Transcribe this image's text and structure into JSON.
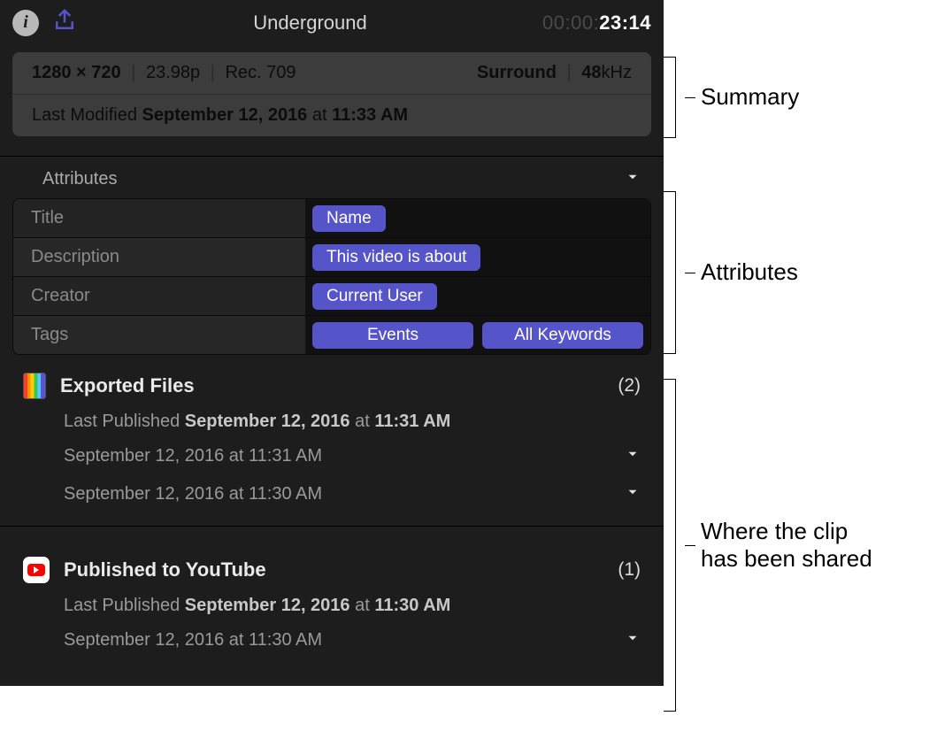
{
  "titlebar": {
    "clip_title": "Underground",
    "timecode_dim": "00:00:",
    "timecode_bright": "23:14"
  },
  "summary": {
    "resolution": "1280 × 720",
    "framerate": "23.98p",
    "colorspace": "Rec. 709",
    "audio_mode": "Surround",
    "audio_rate_num": "48",
    "audio_rate_unit": "kHz",
    "modified_prefix": "Last Modified",
    "modified_date": "September 12, 2016",
    "modified_at": "at",
    "modified_time": "11:33 AM"
  },
  "attributes": {
    "header": "Attributes",
    "rows": [
      {
        "label": "Title",
        "tokens": [
          "Name"
        ]
      },
      {
        "label": "Description",
        "tokens": [
          "This video is about"
        ]
      },
      {
        "label": "Creator",
        "tokens": [
          "Current User"
        ]
      },
      {
        "label": "Tags",
        "tokens": [
          "Events",
          "All Keywords"
        ]
      }
    ]
  },
  "shares": [
    {
      "icon": "file",
      "name": "Exported Files",
      "count": "(2)",
      "last_prefix": "Last Published",
      "last_date": "September 12, 2016",
      "last_at": "at",
      "last_time": "11:31 AM",
      "items": [
        "September 12, 2016 at 11:31 AM",
        "September 12, 2016 at 11:30 AM"
      ]
    },
    {
      "icon": "youtube",
      "name": "Published to YouTube",
      "count": "(1)",
      "last_prefix": "Last Published",
      "last_date": "September 12, 2016",
      "last_at": "at",
      "last_time": "11:30 AM",
      "items": [
        "September 12, 2016 at 11:30 AM"
      ]
    }
  ],
  "annotations": {
    "summary": "Summary",
    "attributes": "Attributes",
    "shared": "Where the clip has been shared"
  }
}
